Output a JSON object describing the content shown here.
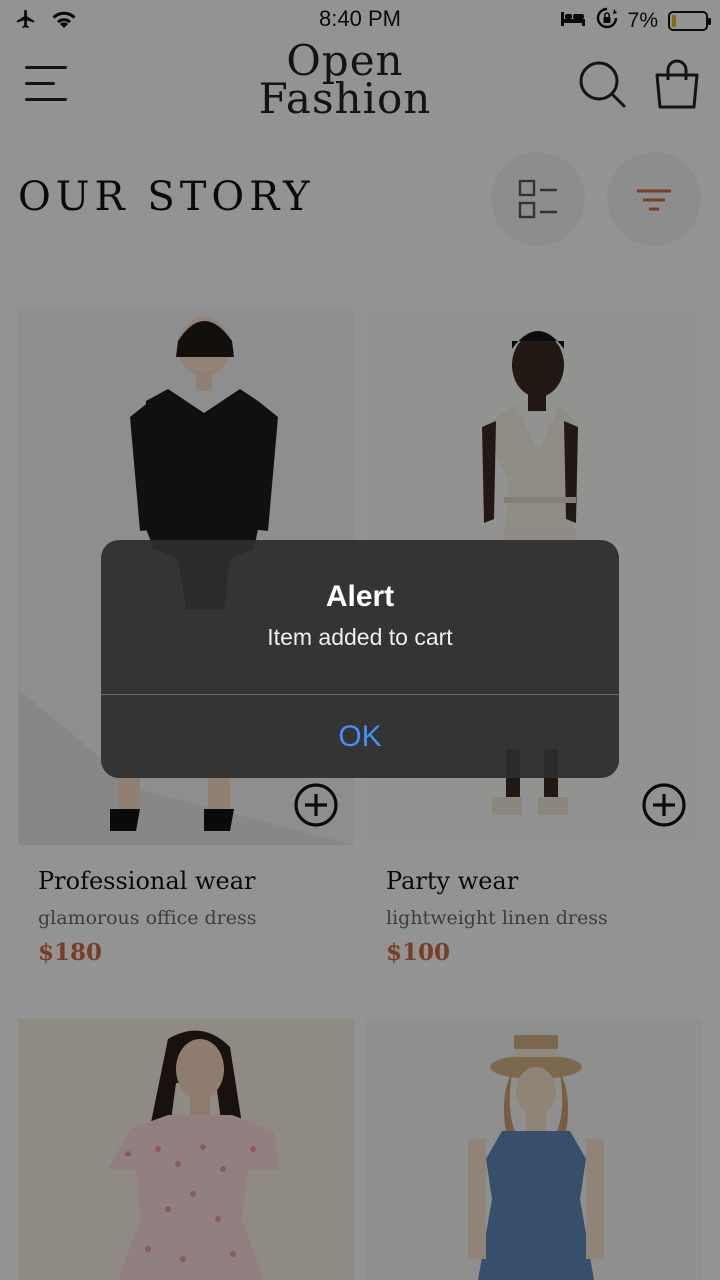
{
  "status_bar": {
    "time": "8:40 PM",
    "battery_percent": "7%",
    "battery_level": 0.07,
    "icons": [
      "airplane-icon",
      "wifi-icon",
      "sleep-icon",
      "orientation-lock-icon",
      "battery-icon"
    ]
  },
  "header": {
    "logo_line1": "Open",
    "logo_line2": "Fashion",
    "icons": [
      "menu-icon",
      "search-icon",
      "shopping-bag-icon"
    ]
  },
  "page": {
    "title": "OUR STORY",
    "view_toggle_icon": "list-view-icon",
    "filter_icon": "filter-icon",
    "accent_color": "#c9663f"
  },
  "products": [
    {
      "name": "Professional wear",
      "description": "glamorous office dress",
      "price": "$180"
    },
    {
      "name": "Party wear",
      "description": "lightweight linen dress",
      "price": "$100"
    },
    {
      "name": "",
      "description": "",
      "price": ""
    },
    {
      "name": "",
      "description": "",
      "price": ""
    }
  ],
  "alert": {
    "title": "Alert",
    "message": "Item added to cart",
    "ok_label": "OK",
    "ok_color": "#4a8ef4"
  }
}
